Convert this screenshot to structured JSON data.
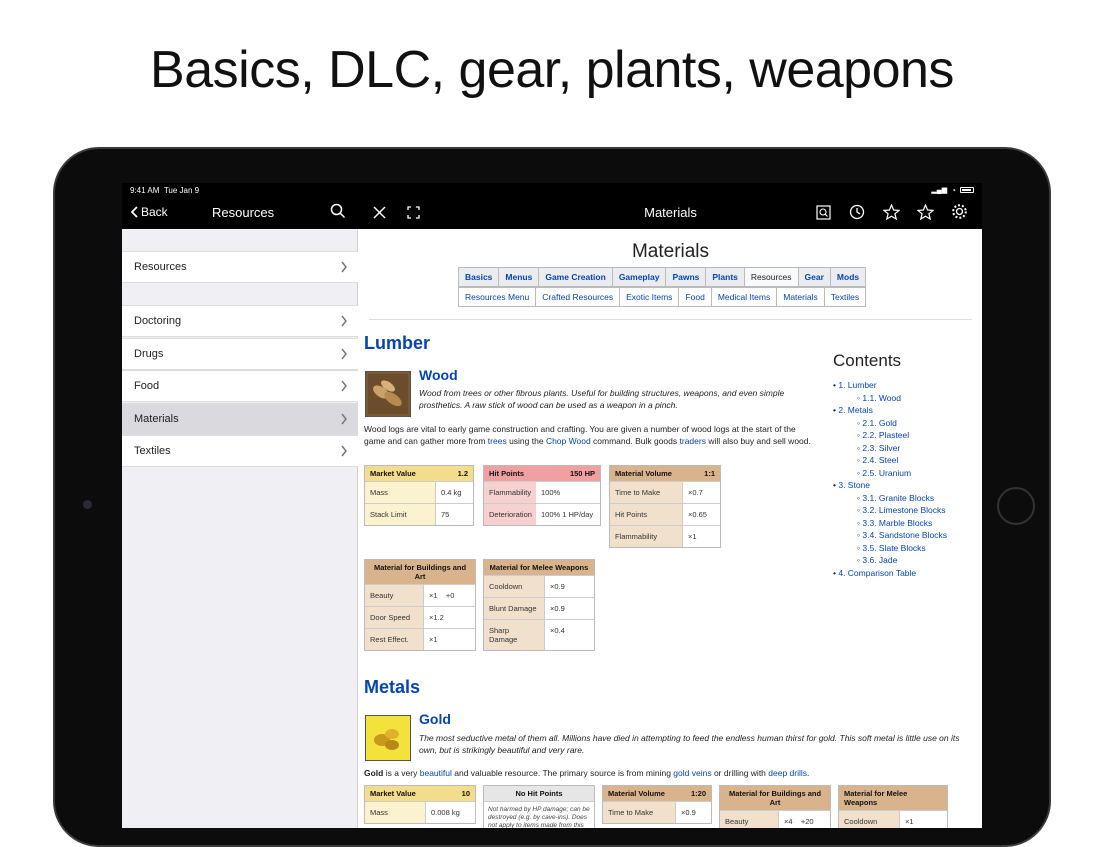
{
  "headline": "Basics, DLC, gear, plants, weapons",
  "status": {
    "time": "9:41 AM",
    "date": "Tue Jan 9"
  },
  "sidebar_nav": {
    "back_label": "Back",
    "title": "Resources"
  },
  "detail_nav": {
    "title": "Materials"
  },
  "sidebar": {
    "items": [
      {
        "label": "Resources"
      },
      {
        "label": "Doctoring"
      },
      {
        "label": "Drugs"
      },
      {
        "label": "Food"
      },
      {
        "label": "Materials"
      },
      {
        "label": "Textiles"
      }
    ]
  },
  "article": {
    "title": "Materials",
    "nav_top": [
      "Basics",
      "Menus",
      "Game Creation",
      "Gameplay",
      "Pawns",
      "Plants",
      "Resources",
      "Gear",
      "Mods"
    ],
    "nav_sub": [
      "Resources Menu",
      "Crafted Resources",
      "Exotic Items",
      "Food",
      "Medical Items",
      "Materials",
      "Textiles"
    ],
    "lumber": {
      "heading": "Lumber",
      "wood_title": "Wood",
      "wood_desc": "Wood from trees or other fibrous plants. Useful for building structures, weapons, and even simple prosthetics. A raw stick of wood can be used as a weapon in a pinch.",
      "para_1": "Wood logs are vital to early game construction and crafting. You are given a number of wood logs at the start of the game and can gather more from ",
      "link_trees": "trees",
      "para_2": " using the ",
      "link_chop": "Chop Wood",
      "para_3": " command. Bulk goods ",
      "link_traders": "traders",
      "para_4": " will also buy and sell wood."
    },
    "wood_tables": {
      "market": {
        "title": "Market Value",
        "value": "1.2",
        "rows": [
          [
            "Mass",
            "0.4 kg"
          ],
          [
            "Stack Limit",
            "75"
          ]
        ]
      },
      "hp": {
        "title": "Hit Points",
        "value": "150 HP",
        "rows": [
          [
            "Flammability",
            "100%"
          ],
          [
            "Deterioration",
            "100%  1 HP/day"
          ]
        ]
      },
      "volume": {
        "title": "Material Volume",
        "value": "1:1",
        "rows": [
          [
            "Time to Make",
            "×0.7"
          ],
          [
            "Hit Points",
            "×0.65"
          ],
          [
            "Flammability",
            "×1"
          ]
        ]
      },
      "buildings": {
        "title": "Material for Buildings and Art",
        "rows": [
          [
            "Beauty",
            "×1    +0"
          ],
          [
            "Door Speed",
            "×1.2"
          ],
          [
            "Rest Effect.",
            "×1"
          ]
        ]
      },
      "melee": {
        "title": "Material for Melee Weapons",
        "rows": [
          [
            "Cooldown",
            "×0.9"
          ],
          [
            "Blunt Damage",
            "×0.9"
          ],
          [
            "Sharp Damage",
            "×0.4"
          ]
        ]
      }
    },
    "metals": {
      "heading": "Metals",
      "gold_title": "Gold",
      "gold_desc": "The most seductive metal of them all. Millions have died in attempting to feed the endless human thirst for gold. This soft metal is little use on its own, but is strikingly beautiful and very rare.",
      "gold_bold": "Gold",
      "para_1": " is a very ",
      "link_beautiful": "beautiful",
      "para_2": " and valuable resource. The primary source is from mining ",
      "link_veins": "gold veins",
      "para_3": " or drilling with ",
      "link_drills": "deep drills",
      "para_4": "."
    },
    "gold_tables": {
      "market": {
        "title": "Market Value",
        "value": "10",
        "rows": [
          [
            "Mass",
            "0.008 kg"
          ]
        ]
      },
      "hp": {
        "title": "No Hit Points",
        "note": "Not harmed by HP damage; can be destroyed (e.g. by cave-ins). Does not apply to items made from this"
      },
      "volume": {
        "title": "Material Volume",
        "value": "1:20",
        "rows": [
          [
            "Time to Make",
            "×0.9"
          ]
        ]
      },
      "buildings": {
        "title": "Material for Buildings and Art",
        "rows": [
          [
            "Beauty",
            "×4    +20"
          ]
        ]
      },
      "melee": {
        "title": "Material for Melee Weapons",
        "rows": [
          [
            "Cooldown",
            "×1"
          ]
        ]
      }
    },
    "contents": {
      "heading": "Contents",
      "items": [
        {
          "label": "1. Lumber",
          "level": 1
        },
        {
          "label": "1.1. Wood",
          "level": 2
        },
        {
          "label": "2. Metals",
          "level": 1
        },
        {
          "label": "2.1. Gold",
          "level": 2
        },
        {
          "label": "2.2. Plasteel",
          "level": 2
        },
        {
          "label": "2.3. Silver",
          "level": 2
        },
        {
          "label": "2.4. Steel",
          "level": 2
        },
        {
          "label": "2.5. Uranium",
          "level": 2
        },
        {
          "label": "3. Stone",
          "level": 1
        },
        {
          "label": "3.1. Granite Blocks",
          "level": 2
        },
        {
          "label": "3.2. Limestone Blocks",
          "level": 2
        },
        {
          "label": "3.3. Marble Blocks",
          "level": 2
        },
        {
          "label": "3.4. Sandstone Blocks",
          "level": 2
        },
        {
          "label": "3.5. Slate Blocks",
          "level": 2
        },
        {
          "label": "3.6. Jade",
          "level": 2
        },
        {
          "label": "4. Comparison Table",
          "level": 1
        }
      ]
    }
  }
}
